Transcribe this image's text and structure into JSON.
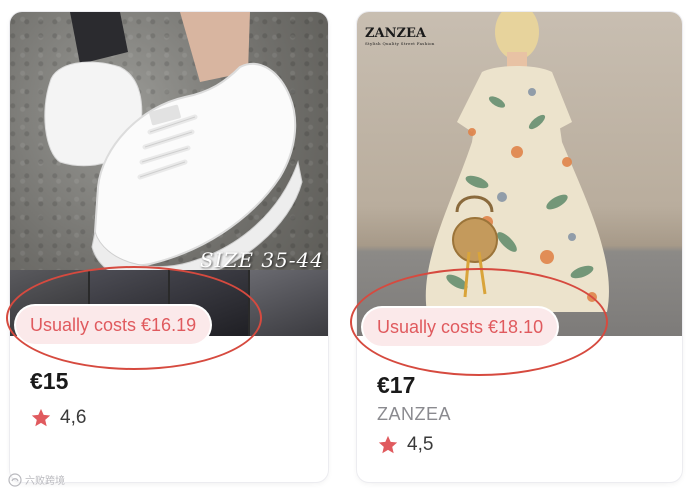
{
  "products": [
    {
      "image_overlay_text": "SIZE 35-44",
      "usually_costs": "Usually costs €16.19",
      "price": "€15",
      "rating": "4,6"
    },
    {
      "image_brand_logo": "ZANZEA",
      "usually_costs": "Usually costs €18.10",
      "price": "€17",
      "brand": "ZANZEA",
      "rating": "4,5"
    }
  ],
  "watermark": "六败跨境",
  "colors": {
    "badge_text": "#e05a5e",
    "badge_bg": "#fbe9ea",
    "star": "#e05a5e",
    "annotation_ellipse": "#d64a3f"
  }
}
